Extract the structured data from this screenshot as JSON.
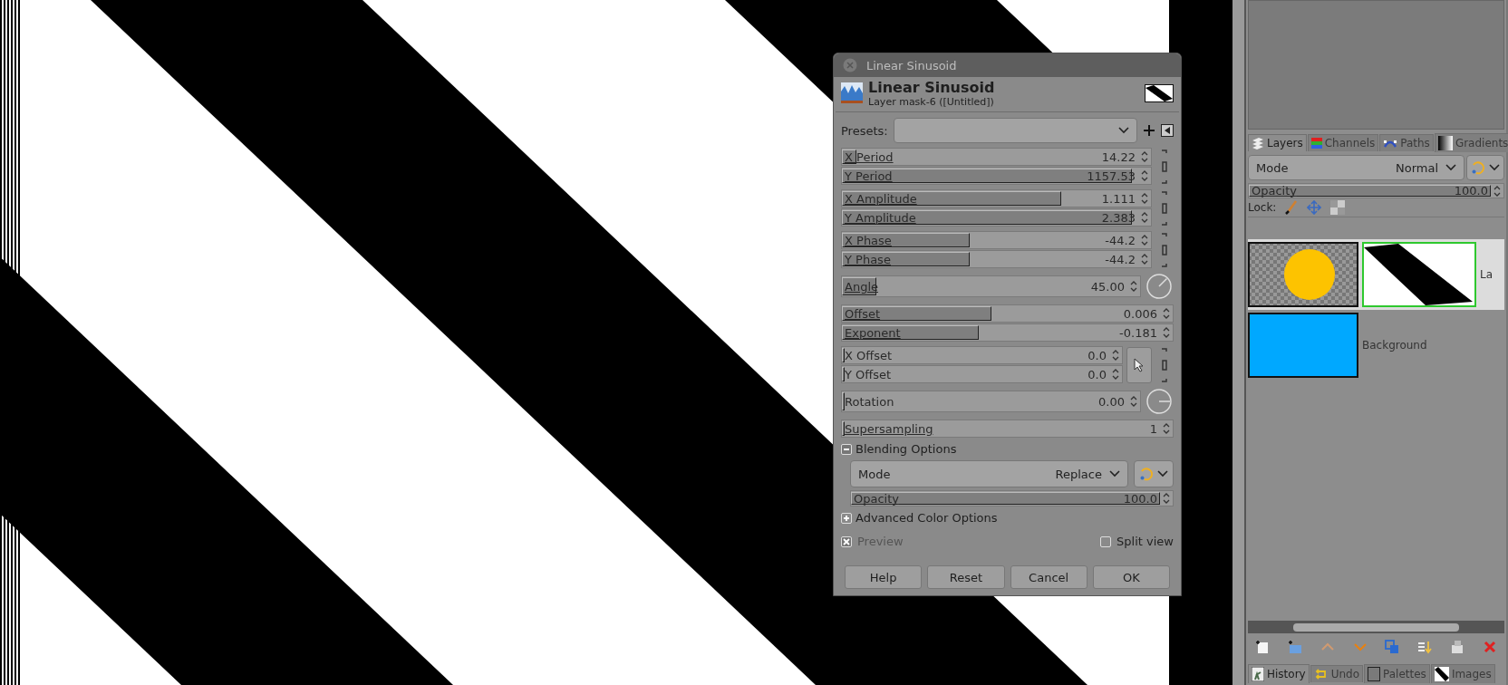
{
  "dialog": {
    "title": "Linear Sinusoid",
    "header": {
      "title": "Linear Sinusoid",
      "subtitle": "Layer mask-6 ([Untitled])"
    },
    "presets": {
      "label": "Presets:"
    },
    "groups": [
      {
        "kind": "chain",
        "rows": [
          {
            "label": "X Period",
            "value": "14.22",
            "level": 0.05
          },
          {
            "label": "Y Period",
            "value": "1157.53",
            "level": 0.98
          }
        ]
      },
      {
        "kind": "chain",
        "rows": [
          {
            "label": "X Amplitude",
            "value": "1.111",
            "level": 0.74
          },
          {
            "label": "Y Amplitude",
            "value": "2.383",
            "level": 0.98
          }
        ]
      },
      {
        "kind": "chain",
        "rows": [
          {
            "label": "X Phase",
            "value": "-44.2",
            "level": 0.43
          },
          {
            "label": "Y Phase",
            "value": "-44.2",
            "level": 0.43
          }
        ]
      },
      {
        "kind": "dial",
        "rows": [
          {
            "label": "Angle",
            "value": "45.00",
            "level": 0.12
          }
        ]
      },
      {
        "kind": "plain",
        "rows": [
          {
            "label": "Offset",
            "value": "0.006",
            "level": 0.47
          },
          {
            "label": "Exponent",
            "value": "-0.181",
            "level": 0.43
          }
        ]
      },
      {
        "kind": "picker",
        "rows": [
          {
            "label": "X Offset",
            "value": "0.0",
            "level": 0
          },
          {
            "label": "Y Offset",
            "value": "0.0",
            "level": 0
          }
        ]
      },
      {
        "kind": "dial",
        "rows": [
          {
            "label": "Rotation",
            "value": "0.00",
            "level": 0
          }
        ]
      },
      {
        "kind": "plain",
        "rows": [
          {
            "label": "Supersampling",
            "value": "1",
            "level": 0
          }
        ]
      }
    ],
    "blending": {
      "label": "Blending Options",
      "expanded": true,
      "mode_label": "Mode",
      "mode_value": "Replace",
      "opacity": {
        "label": "Opacity",
        "value": "100.0",
        "level": 1
      }
    },
    "advanced": {
      "label": "Advanced Color Options",
      "expanded": false
    },
    "preview": {
      "label": "Preview",
      "checked": true
    },
    "split_view": {
      "label": "Split view",
      "checked": false
    },
    "buttons": [
      "Help",
      "Reset",
      "Cancel",
      "OK"
    ]
  },
  "panel": {
    "tabs": [
      {
        "label": "Layers",
        "selected": true
      },
      {
        "label": "Channels",
        "selected": false
      },
      {
        "label": "Paths",
        "selected": false
      },
      {
        "label": "Gradients",
        "selected": false
      }
    ],
    "mode": {
      "label": "Mode",
      "value": "Normal"
    },
    "opacity": {
      "label": "Opacity",
      "value": "100.0",
      "level": 1
    },
    "lock_label": "Lock:",
    "layers": [
      {
        "name": "La",
        "selected": true,
        "kind": "masked"
      },
      {
        "name": "Background",
        "selected": false,
        "kind": "fill"
      }
    ],
    "bottom_tabs": [
      {
        "label": "History",
        "selected": true
      },
      {
        "label": "Undo",
        "selected": false
      },
      {
        "label": "Palettes",
        "selected": false
      },
      {
        "label": "Images",
        "selected": false
      }
    ]
  }
}
